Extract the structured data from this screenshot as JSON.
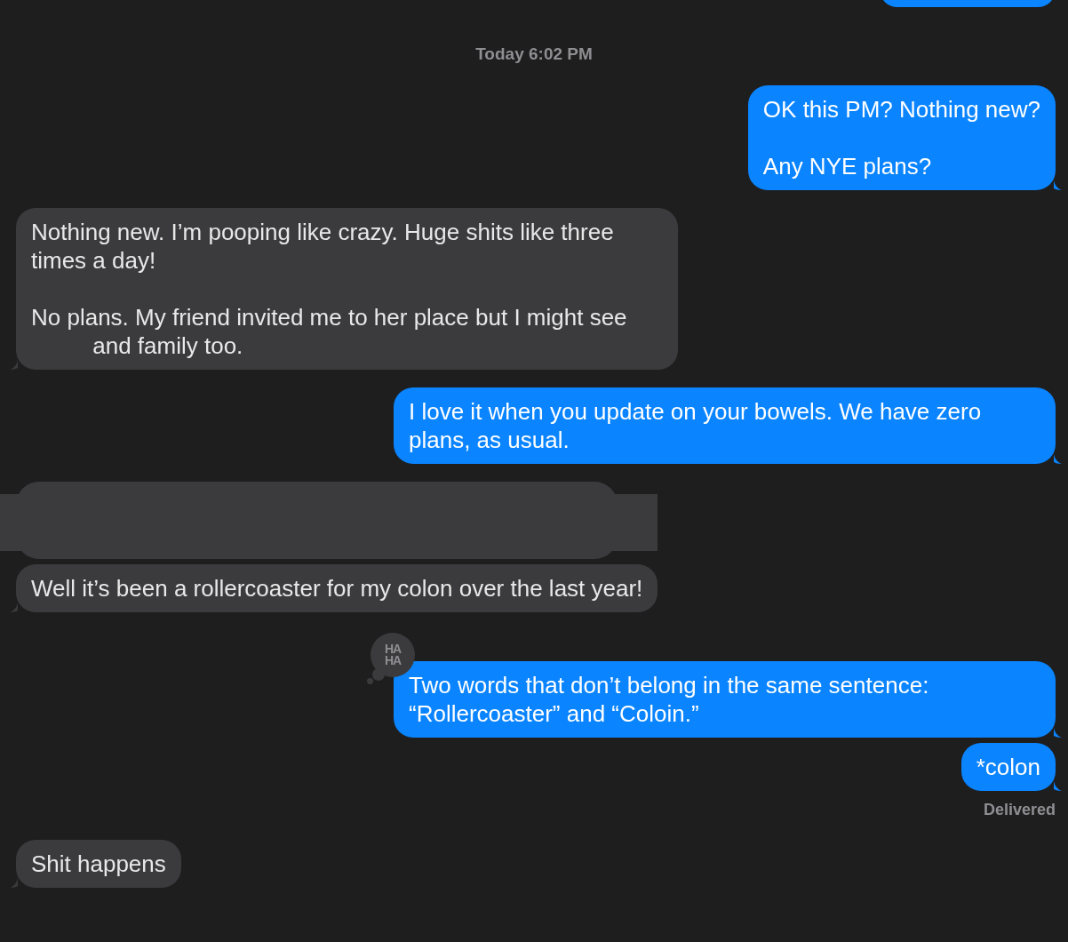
{
  "messages": [
    {
      "outgoing": true,
      "kind": "cut"
    },
    {
      "kind": "timestamp",
      "text": "**Today** 6:02 PM"
    },
    {
      "outgoing": true,
      "kind": "text",
      "paragraphs": [
        [
          {
            "text": "OK this PM? Nothing new?"
          }
        ],
        [
          {
            "text": "Any NYE plans?"
          }
        ]
      ]
    },
    {
      "outgoing": false,
      "kind": "text",
      "paragraphs": [
        [
          {
            "text": "Nothing new. I’m pooping like crazy. Huge shits like three times a day!"
          }
        ],
        [
          {
            "text": "No plans. My friend invited me to her place but I might see"
          },
          {
            "kind": "redaction"
          },
          {
            "text": "and family too."
          }
        ]
      ]
    },
    {
      "outgoing": true,
      "kind": "text",
      "paragraphs": [
        [
          {
            "text": "I love it when you update on your bowels. We have zero plans, as usual."
          }
        ]
      ]
    },
    {
      "outgoing": false,
      "kind": "redacted"
    },
    {
      "outgoing": false,
      "kind": "text",
      "paragraphs": [
        [
          {
            "text": "Well it’s been a rollercoaster for my colon over the last year!"
          }
        ]
      ]
    },
    {
      "outgoing": true,
      "kind": "text",
      "reaction": [
        "HA",
        "HA"
      ],
      "paragraphs": [
        [
          {
            "text": "Two words that don’t belong in the same sentence: “Rollercoaster” and “Coloin.”"
          }
        ]
      ]
    },
    {
      "outgoing": true,
      "kind": "text",
      "paragraphs": [
        [
          {
            "text": "*colon"
          }
        ]
      ],
      "receipt": "Delivered"
    },
    {
      "outgoing": false,
      "kind": "text",
      "paragraphs": [
        [
          {
            "text": "Shit happens"
          }
        ]
      ]
    }
  ]
}
